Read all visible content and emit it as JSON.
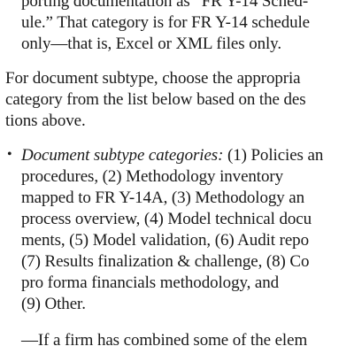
{
  "para1": {
    "line1": "porting documentation as “FR Y-14 Sched-",
    "line2": "ule.” That category is for FR Y-14 schedule",
    "line3": "only—that is, Excel or XML files only."
  },
  "para2": {
    "line1": "For document subtype, choose the appropria",
    "line2": "category from the list below based on the des",
    "line3": "tions above."
  },
  "bullet_item": {
    "bullet": "•",
    "lead": "Document subtype categories:",
    "line1_rest": " (1) Policies an",
    "line2": "procedures, (2) Methodology inventory",
    "line3": "mapped to FR Y-14A, (3) Methodology an",
    "line4": "process overview, (4) Model technical docu",
    "line5": "ments, (5) Model validation, (6) Audit repo",
    "line6": "(7) Results finalization & challenge, (8) Co",
    "line7": "pro forma financials methodology, and",
    "line8": "(9) Other."
  },
  "para3": {
    "line1": "—If a firm has combined some of the elem"
  }
}
